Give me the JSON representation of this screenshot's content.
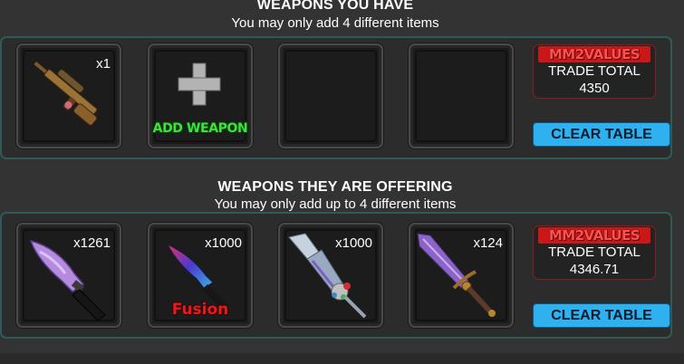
{
  "your_side": {
    "heading": "WEAPONS YOU HAVE",
    "subheading": "You may only add 4 different items",
    "slots": [
      {
        "item": "sniper-rifle-icon",
        "quantity": "x1"
      },
      {
        "item": "add-weapon",
        "label": "ADD WEAPON"
      },
      {
        "item": "empty"
      },
      {
        "item": "empty"
      }
    ],
    "total": {
      "logo": "MM2VALUES",
      "label": "TRADE TOTAL",
      "value": "4350"
    },
    "clear_label": "CLEAR TABLE"
  },
  "their_side": {
    "heading": "WEAPONS THEY ARE OFFERING",
    "subheading": "You may only add up to 4 different items",
    "slots": [
      {
        "item": "purple-knife-icon",
        "quantity": "x1261"
      },
      {
        "item": "fusion-knife-icon",
        "quantity": "x1000",
        "label": "Fusion"
      },
      {
        "item": "crystal-scepter-icon",
        "quantity": "x1000"
      },
      {
        "item": "ornate-sword-icon",
        "quantity": "x124"
      }
    ],
    "total": {
      "logo": "MM2VALUES",
      "label": "TRADE TOTAL",
      "value": "4346.71"
    },
    "clear_label": "CLEAR TABLE"
  },
  "colors": {
    "panel_border": "#2f5a55",
    "clear_button": "#2fb0ef",
    "logo_red": "#c81818",
    "add_green": "#3fe03f",
    "fusion_red": "#e61c1c"
  }
}
